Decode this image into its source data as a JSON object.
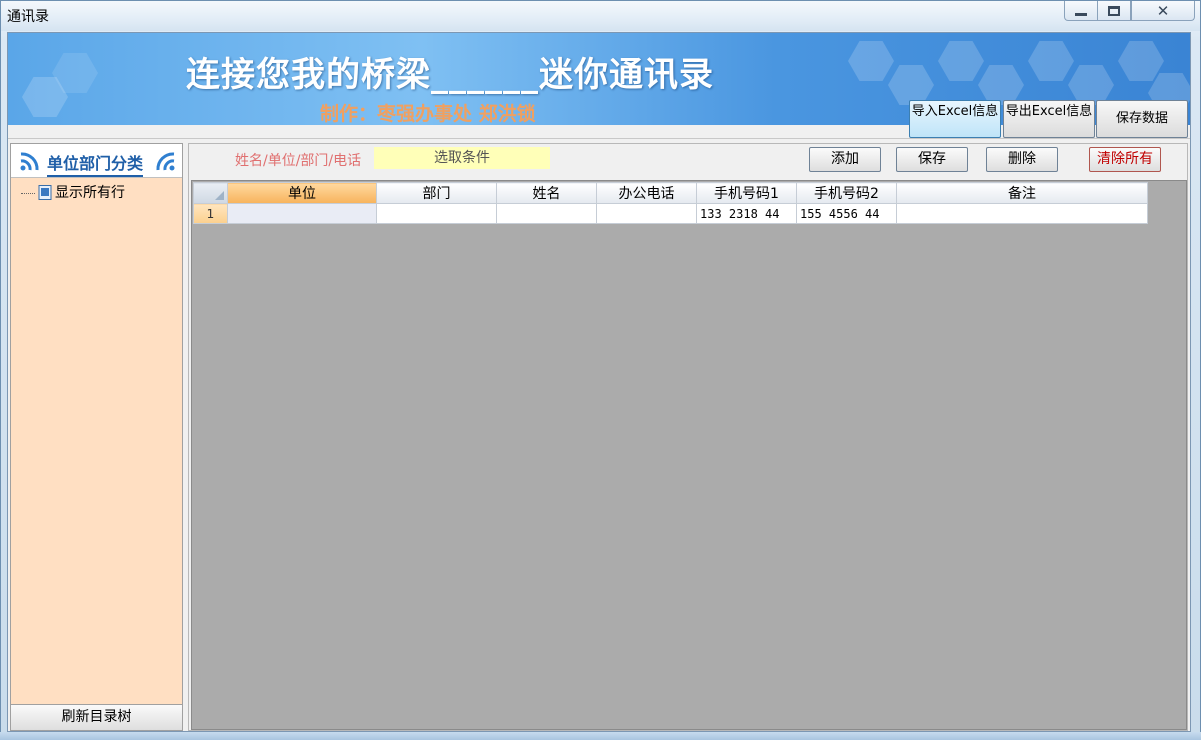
{
  "window": {
    "title": "通讯录"
  },
  "banner": {
    "title": "连接您我的桥梁______迷你通讯录",
    "subtitle": "制作：枣强办事处 郑洪锁"
  },
  "toolbar": {
    "import_label": "导入Excel信息",
    "export_label": "导出Excel信息",
    "savedata_label": "保存数据"
  },
  "sidebar": {
    "title": "单位部门分类",
    "tree_items": [
      {
        "label": "显示所有行"
      }
    ],
    "refresh_label": "刷新目录树"
  },
  "filter": {
    "label": "姓名/单位/部门/电话",
    "value": "选取条件"
  },
  "actions": {
    "add": "添加",
    "save": "保存",
    "delete": "删除",
    "clear": "清除所有"
  },
  "grid": {
    "columns": [
      "单位",
      "部门",
      "姓名",
      "办公电话",
      "手机号码1",
      "手机号码2",
      "备注"
    ],
    "rows": [
      {
        "num": "1",
        "cells": [
          "",
          "",
          "",
          "",
          "133 2318 44",
          "155 4556 44",
          ""
        ]
      }
    ]
  },
  "colors": {
    "accent": "#1f5fa8",
    "danger": "#c00000",
    "sidebar_bg": "#ffdfc2",
    "grid_bg": "#ababab"
  }
}
